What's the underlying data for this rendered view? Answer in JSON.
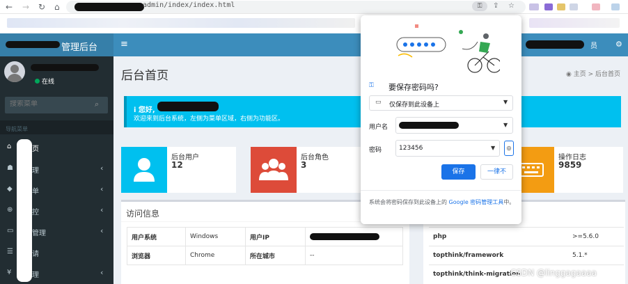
{
  "browser": {
    "url": "admin/index/index.html",
    "back_icon": "arrow-left",
    "forward_icon": "arrow-right",
    "reload_icon": "reload",
    "home_icon": "home",
    "key_icon": "key"
  },
  "app": {
    "logo_text": "管理后台",
    "user_status": "在线",
    "search_placeholder": "搜索菜单",
    "nav_header": "导航菜单",
    "menu": [
      {
        "icon": "home-icon",
        "label": "页"
      },
      {
        "icon": "users-icon",
        "label": "理"
      },
      {
        "icon": "cube-icon",
        "label": "单"
      },
      {
        "icon": "lock-icon",
        "label": "控"
      },
      {
        "icon": "money-icon",
        "label": "管理"
      },
      {
        "icon": "list-icon",
        "label": "请"
      },
      {
        "icon": "yen-icon",
        "label": "理"
      }
    ],
    "header_user": "员"
  },
  "page": {
    "title": "后台首页",
    "breadcrumb_home": "主页",
    "breadcrumb_current": "后台首页",
    "callout_title": "i 您好,",
    "callout_text": "欢迎来到后台系统，左侧为菜单区域，右侧为功能区。",
    "boxes": [
      {
        "label": "后台用户",
        "value": "12",
        "color": "#00c0ef"
      },
      {
        "label": "后台角色",
        "value": "3",
        "color": "#dd4b39"
      },
      {
        "label": "操作日志",
        "value": "9859",
        "color": "#f39c12"
      }
    ],
    "visit_title": "访问信息",
    "visit_rows": [
      [
        "用户系统",
        "Windows",
        "用户IP",
        ""
      ],
      [
        "浏览器",
        "Chrome",
        "所在城市",
        "--"
      ]
    ],
    "env_rows": [
      [
        "php",
        ">=5.6.0"
      ],
      [
        "topthink/framework",
        "5.1.*"
      ],
      [
        "topthink/think-migration",
        ""
      ]
    ],
    "watermark": "CSDN @linggagaaaa"
  },
  "popup": {
    "title": "要保存密码吗?",
    "storage_option": "仅保存到此设备上",
    "username_label": "用户名",
    "password_label": "密码",
    "password_value": "123456",
    "save_label": "保存",
    "never_label": "一律不",
    "footer_text": "系统会将密码保存到此设备上的",
    "footer_link": "Google 密码管理工具",
    "footer_end": "中。"
  }
}
